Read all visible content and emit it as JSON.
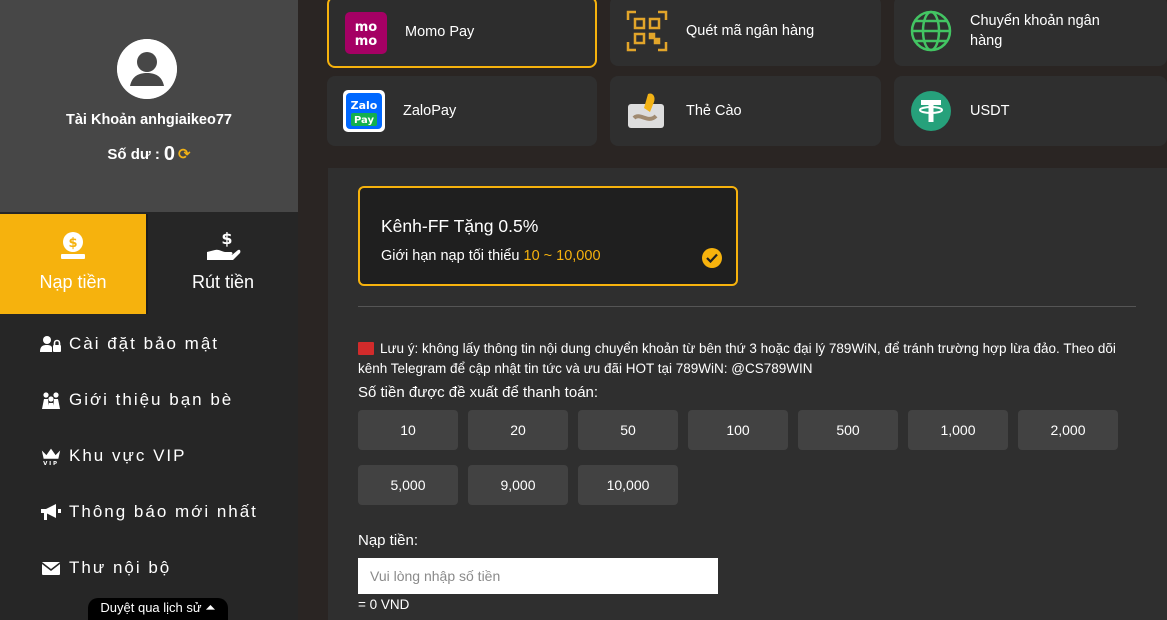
{
  "profile": {
    "username": "Tài Khoản anhgiaikeo77",
    "balance_label": "Số dư :",
    "balance_value": "0"
  },
  "tabs": {
    "deposit": "Nạp tiền",
    "withdraw": "Rút tiền"
  },
  "menu": [
    {
      "label": "Cài đặt bảo mật",
      "icon": "user-lock-icon"
    },
    {
      "label": "Giới thiệu bạn bè",
      "icon": "people-icon"
    },
    {
      "label": "Khu vực VIP",
      "icon": "vip-crown-icon"
    },
    {
      "label": "Thông báo mới nhất",
      "icon": "megaphone-icon"
    },
    {
      "label": "Thư nội bộ",
      "icon": "envelope-icon"
    }
  ],
  "history_link": "Duyệt qua lịch sử ⏶",
  "methods": [
    {
      "label": "Momo Pay",
      "icon": "momo-icon"
    },
    {
      "label": "Quét mã ngân hàng",
      "icon": "qr-code-icon"
    },
    {
      "label": "Chuyển khoản ngân hàng",
      "icon": "globe-icon"
    },
    {
      "label": "ZaloPay",
      "icon": "zalopay-icon"
    },
    {
      "label": "Thẻ Cào",
      "icon": "scratch-card-icon"
    },
    {
      "label": "USDT",
      "icon": "tether-icon"
    }
  ],
  "channel": {
    "title": "Kênh-FF Tặng 0.5%",
    "limit_label": "Giới hạn nạp tối thiểu",
    "limit_range": "10 ~ 10,000"
  },
  "notice": "Lưu ý: không lấy thông tin nội dung chuyển khoản từ bên thứ 3 hoặc đại lý 789WiN, để tránh trường hợp lừa đảo. Theo dõi kênh Telegram để cập nhật tin tức và ưu đãi HOT tại 789WiN: @CS789WIN",
  "suggest_label": "Số tiền được đề xuất để thanh toán:",
  "amounts": [
    "10",
    "20",
    "50",
    "100",
    "500",
    "1,000",
    "2,000",
    "5,000",
    "9,000",
    "10,000"
  ],
  "deposit_form": {
    "label": "Nạp tiền:",
    "placeholder": "Vui lòng nhập số tiền",
    "converted": "= 0 VND"
  },
  "colors": {
    "accent": "#f6b20d",
    "sidebar": "#262626",
    "profile_bg": "#474747",
    "panel": "#2f2f2f"
  }
}
